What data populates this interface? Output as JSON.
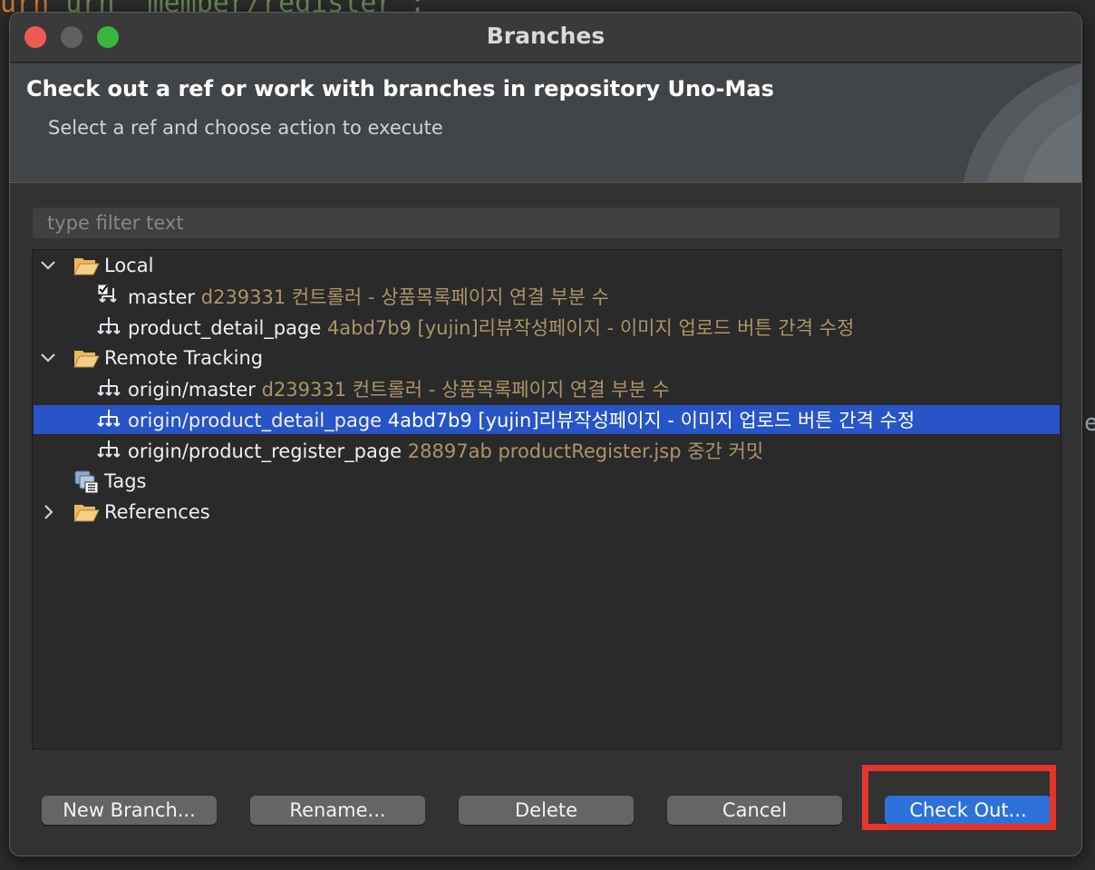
{
  "background": {
    "code_fragment": "urn \"member/register\";"
  },
  "window": {
    "title": "Branches"
  },
  "banner": {
    "title": "Check out a ref or work with branches in repository Uno-Mas",
    "subtitle": "Select a ref and choose action to execute"
  },
  "filter": {
    "placeholder": "type filter text",
    "value": ""
  },
  "tree": {
    "local": {
      "label": "Local",
      "expanded": true,
      "items": [
        {
          "name": "master",
          "commit": "d239331 컨트롤러 - 상품목록페이지 연결 부분 수",
          "checked_out": true
        },
        {
          "name": "product_detail_page",
          "commit": "4abd7b9 [yujin]리뷰작성페이지 - 이미지 업로드 버튼 간격 수정",
          "checked_out": false
        }
      ]
    },
    "remote": {
      "label": "Remote Tracking",
      "expanded": true,
      "items": [
        {
          "name": "origin/master",
          "commit": "d239331 컨트롤러 - 상품목록페이지 연결 부분 수",
          "selected": false
        },
        {
          "name": "origin/product_detail_page",
          "commit": "4abd7b9 [yujin]리뷰작성페이지 - 이미지 업로드 버튼 간격 수정",
          "selected": true
        },
        {
          "name": "origin/product_register_page",
          "commit": "28897ab productRegister.jsp 중간 커밋",
          "selected": false
        }
      ]
    },
    "tags": {
      "label": "Tags"
    },
    "references": {
      "label": "References",
      "expanded": false
    }
  },
  "buttons": {
    "new_branch": "New Branch...",
    "rename": "Rename...",
    "delete": "Delete",
    "cancel": "Cancel",
    "check_out": "Check Out..."
  },
  "colors": {
    "selection": "#2754c6",
    "primary_button": "#2c72d8",
    "commit_text": "#ab9568",
    "highlight": "#e5352b"
  }
}
